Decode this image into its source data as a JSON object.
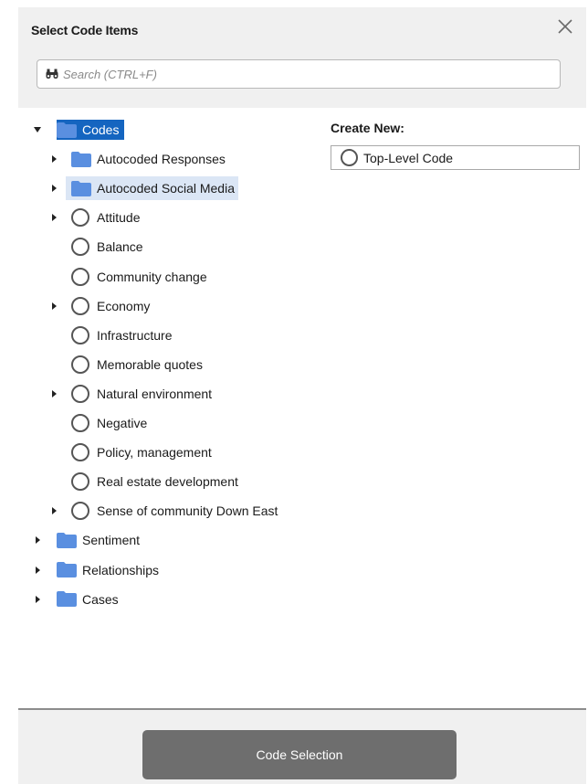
{
  "dialog": {
    "title": "Select Code Items",
    "close_icon": "close-icon"
  },
  "search": {
    "placeholder": "Search (CTRL+F)",
    "value": "",
    "icon": "binoculars-icon"
  },
  "colors": {
    "folder": "#5a8fe0",
    "selected_bg": "#1565c0",
    "hover_bg": "#dbe6f5",
    "header_bg": "#f0f0f0",
    "button_bg": "#6e6e6e"
  },
  "tree": {
    "items": [
      {
        "label": "Codes",
        "type": "folder",
        "depth": 0,
        "expanded": true,
        "has_children": true,
        "selected": true
      },
      {
        "label": "Autocoded Responses",
        "type": "folder",
        "depth": 1,
        "expanded": false,
        "has_children": true
      },
      {
        "label": "Autocoded Social Media",
        "type": "folder",
        "depth": 1,
        "expanded": false,
        "has_children": true,
        "hovered": true
      },
      {
        "label": "Attitude",
        "type": "code",
        "depth": 1,
        "expanded": false,
        "has_children": true
      },
      {
        "label": "Balance",
        "type": "code",
        "depth": 1,
        "has_children": false
      },
      {
        "label": "Community change",
        "type": "code",
        "depth": 1,
        "has_children": false
      },
      {
        "label": "Economy",
        "type": "code",
        "depth": 1,
        "expanded": false,
        "has_children": true
      },
      {
        "label": "Infrastructure",
        "type": "code",
        "depth": 1,
        "has_children": false
      },
      {
        "label": "Memorable quotes",
        "type": "code",
        "depth": 1,
        "has_children": false
      },
      {
        "label": "Natural environment",
        "type": "code",
        "depth": 1,
        "expanded": false,
        "has_children": true
      },
      {
        "label": "Negative",
        "type": "code",
        "depth": 1,
        "has_children": false
      },
      {
        "label": "Policy, management",
        "type": "code",
        "depth": 1,
        "has_children": false
      },
      {
        "label": "Real estate development",
        "type": "code",
        "depth": 1,
        "has_children": false
      },
      {
        "label": "Sense of community Down East",
        "type": "code",
        "depth": 1,
        "expanded": false,
        "has_children": true
      },
      {
        "label": "Sentiment",
        "type": "folder",
        "depth": 0,
        "expanded": false,
        "has_children": true
      },
      {
        "label": "Relationships",
        "type": "folder",
        "depth": 0,
        "expanded": false,
        "has_children": true
      },
      {
        "label": "Cases",
        "type": "folder",
        "depth": 0,
        "expanded": false,
        "has_children": true
      }
    ]
  },
  "create_new": {
    "title": "Create New:",
    "top_level_label": "Top-Level Code"
  },
  "footer": {
    "code_selection_label": "Code Selection"
  }
}
